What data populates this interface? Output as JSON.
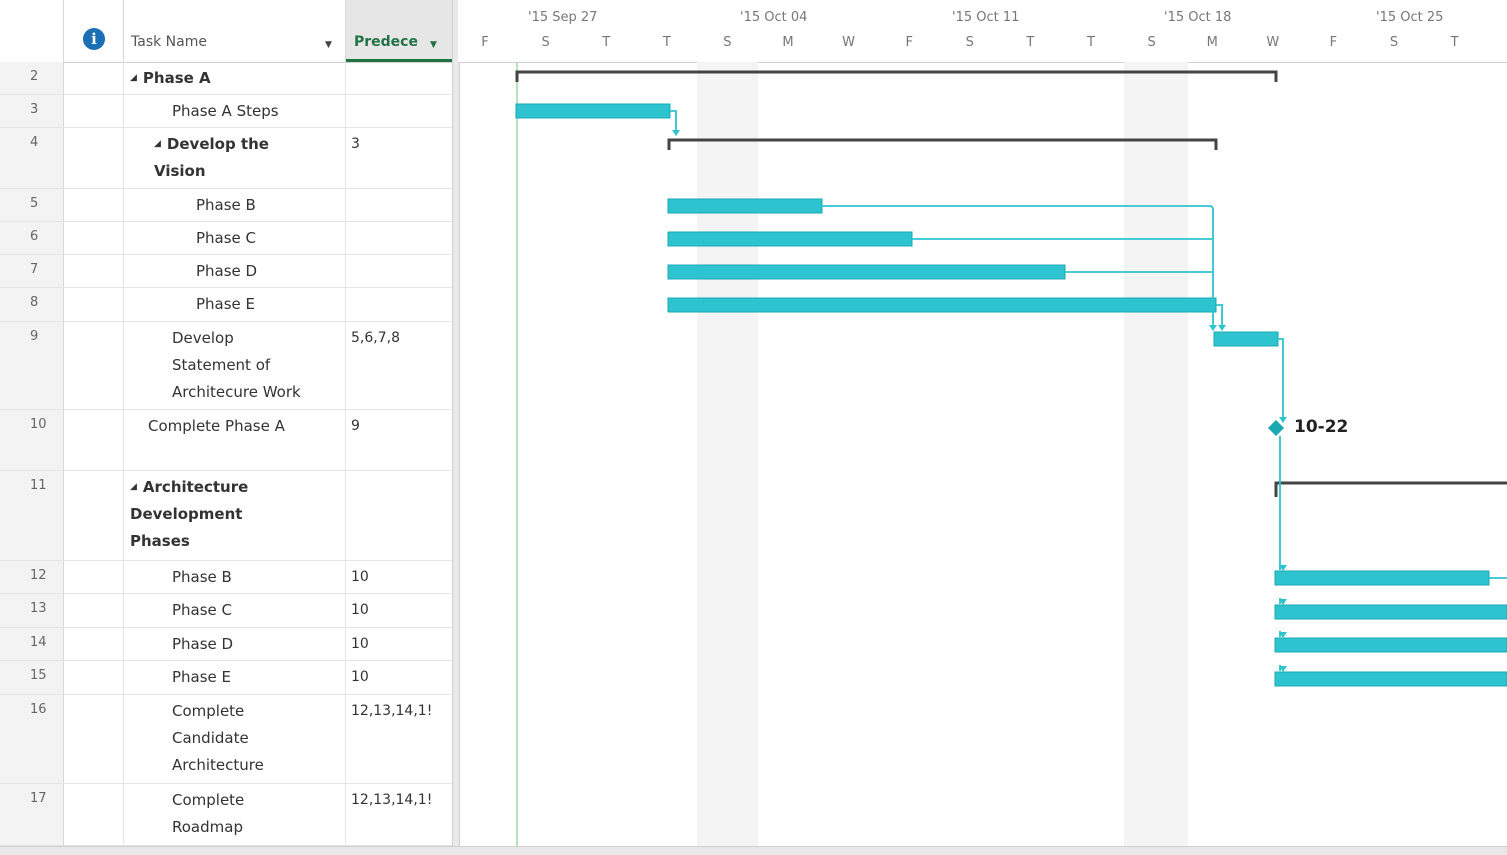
{
  "columns": {
    "name": "Task Name",
    "predecessors": "Predece"
  },
  "timescale": {
    "weeks": [
      "'15 Sep 27",
      "'15 Oct 04",
      "'15 Oct 11",
      "'15 Oct 18",
      "'15 Oct 25"
    ],
    "days": [
      "F",
      "S",
      "T",
      "T",
      "S",
      "M",
      "W",
      "F",
      "S",
      "T",
      "T",
      "S",
      "M",
      "W",
      "F",
      "S",
      "T"
    ]
  },
  "tasks": [
    {
      "id": "2",
      "name": "Phase A",
      "pred": "",
      "summary": true,
      "lines": [
        "Phase A"
      ]
    },
    {
      "id": "3",
      "name": "Phase A Steps",
      "pred": "",
      "lines": [
        "Phase A Steps"
      ]
    },
    {
      "id": "4",
      "name": "Develop the Vision",
      "pred": "3",
      "summary": true,
      "lines": [
        "Develop the",
        "Vision"
      ]
    },
    {
      "id": "5",
      "name": "Phase B",
      "pred": "",
      "lines": [
        "Phase B"
      ]
    },
    {
      "id": "6",
      "name": "Phase C",
      "pred": "",
      "lines": [
        "Phase C"
      ]
    },
    {
      "id": "7",
      "name": "Phase D",
      "pred": "",
      "lines": [
        "Phase D"
      ]
    },
    {
      "id": "8",
      "name": "Phase E",
      "pred": "",
      "lines": [
        "Phase E"
      ]
    },
    {
      "id": "9",
      "name": "Develop Statement of Architecure Work",
      "pred": "5,6,7,8",
      "lines": [
        "Develop",
        "Statement of",
        "Architecure Work"
      ]
    },
    {
      "id": "10",
      "name": "Complete Phase A",
      "pred": "9",
      "lines": [
        "Complete Phase A"
      ]
    },
    {
      "id": "11",
      "name": "Architecture Development Phases",
      "pred": "",
      "summary": true,
      "lines": [
        "Architecture",
        "Development",
        "Phases"
      ]
    },
    {
      "id": "12",
      "name": "Phase B",
      "pred": "10",
      "lines": [
        "Phase B"
      ]
    },
    {
      "id": "13",
      "name": "Phase C",
      "pred": "10",
      "lines": [
        "Phase C"
      ]
    },
    {
      "id": "14",
      "name": "Phase D",
      "pred": "10",
      "lines": [
        "Phase D"
      ]
    },
    {
      "id": "15",
      "name": "Phase E",
      "pred": "10",
      "lines": [
        "Phase E"
      ]
    },
    {
      "id": "16",
      "name": "Complete Candidate Architecture",
      "pred": "12,13,14,1!",
      "lines": [
        "Complete",
        "Candidate",
        "Architecture"
      ]
    },
    {
      "id": "17",
      "name": "Complete Roadmap",
      "pred": "12,13,14,1!",
      "lines": [
        "Complete",
        "Roadmap"
      ]
    }
  ],
  "milestone_label": "10-22",
  "colors": {
    "bar": "#2ec4cf",
    "summary": "#444444",
    "link": "#2ec4cf",
    "header_accent": "#217346",
    "info": "#1b6fb5"
  }
}
